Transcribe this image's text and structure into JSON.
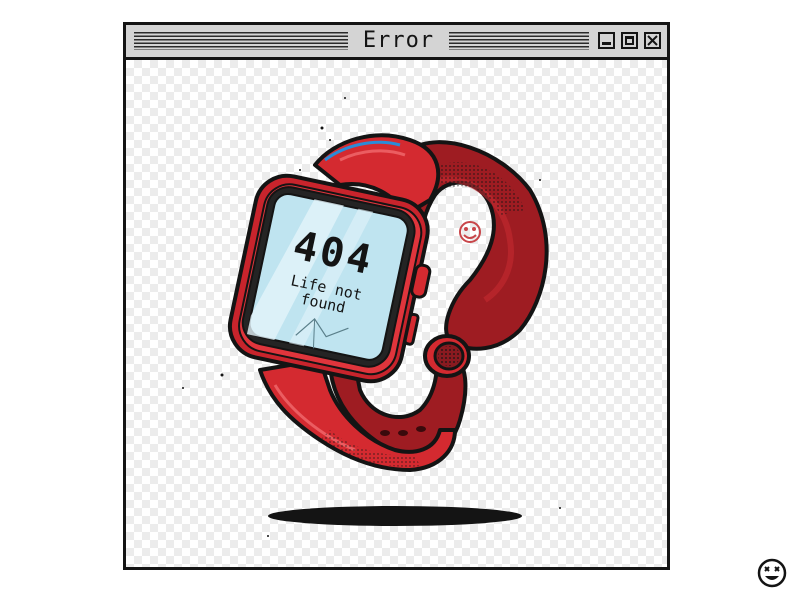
{
  "window": {
    "title": "Error",
    "controls": [
      "minimize",
      "maximize",
      "close"
    ]
  },
  "watch_screen": {
    "code": "404",
    "line1": "Life not",
    "line2": "found"
  },
  "icons": {
    "corner": "dizzy-smiley-icon",
    "band_emblem": "smiley-icon"
  },
  "colors": {
    "band": "#d42a30",
    "band_inner": "#9e1c22",
    "screen": "#bfe4f0",
    "outline": "#141414"
  }
}
